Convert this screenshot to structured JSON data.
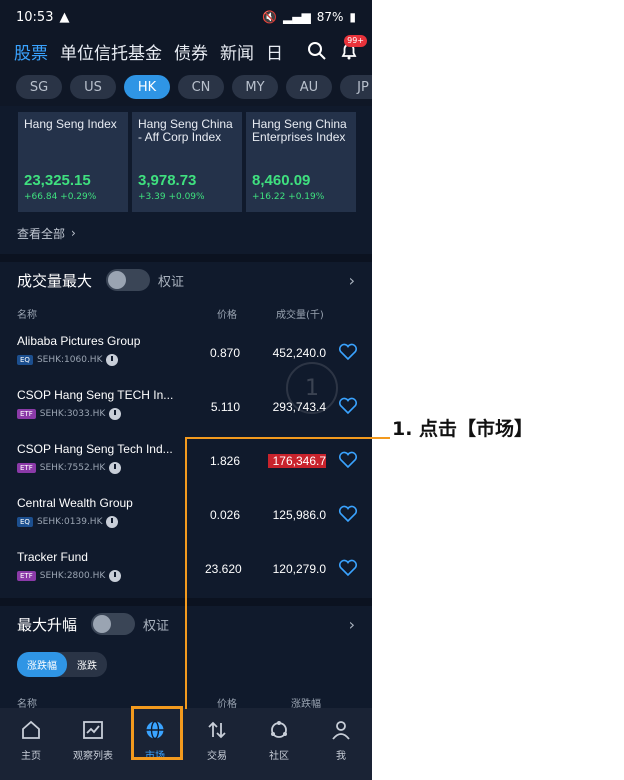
{
  "status": {
    "time": "10:53",
    "battery": "87%"
  },
  "topnav": {
    "tabs": [
      "股票",
      "单位信托基金",
      "债券",
      "新闻",
      "日"
    ],
    "badge": "99+"
  },
  "markets": [
    "SG",
    "US",
    "HK",
    "CN",
    "MY",
    "AU",
    "JP"
  ],
  "indices": [
    {
      "name": "Hang Seng Index",
      "value": "23,325.15",
      "change": "+66.84 +0.29%"
    },
    {
      "name": "Hang Seng China - Aff Corp Index",
      "value": "3,978.73",
      "change": "+3.39 +0.09%"
    },
    {
      "name": "Hang Seng China Enterprises Index",
      "value": "8,460.09",
      "change": "+16.22 +0.19%"
    }
  ],
  "view_all": "查看全部",
  "volume_section": {
    "title": "成交量最大",
    "toggle_label": "权证",
    "col_name": "名称",
    "col_price": "价格",
    "col_volume": "成交量(千)",
    "rows": [
      {
        "name": "Alibaba Pictures Group",
        "tag": "EQ",
        "code": "SEHK:1060.HK",
        "price": "0.870",
        "volume": "452,240.0"
      },
      {
        "name": "CSOP Hang Seng TECH In...",
        "tag": "ETF",
        "code": "SEHK:3033.HK",
        "price": "5.110",
        "volume": "293,743.4"
      },
      {
        "name": "CSOP Hang Seng Tech Ind...",
        "tag": "ETF",
        "code": "SEHK:7552.HK",
        "price": "1.826",
        "volume": "176,346.7"
      },
      {
        "name": "Central Wealth Group",
        "tag": "EQ",
        "code": "SEHK:0139.HK",
        "price": "0.026",
        "volume": "125,986.0"
      },
      {
        "name": "Tracker Fund",
        "tag": "ETF",
        "code": "SEHK:2800.HK",
        "price": "23.620",
        "volume": "120,279.0"
      }
    ]
  },
  "gainers_section": {
    "title": "最大升幅",
    "toggle_label": "权证",
    "pill_active": "涨跌幅",
    "pill_other": "涨跌",
    "col_name": "名称",
    "col_price": "价格",
    "col_change": "涨跌幅"
  },
  "bottomnav": [
    "主页",
    "观察列表",
    "市场",
    "交易",
    "社区",
    "我"
  ],
  "annotation": "1. 点击【市场】",
  "circle_mark": "1",
  "colors": {
    "accent": "#2f95e5",
    "positive": "#3fe07f",
    "highlight": "#f39a1e"
  }
}
